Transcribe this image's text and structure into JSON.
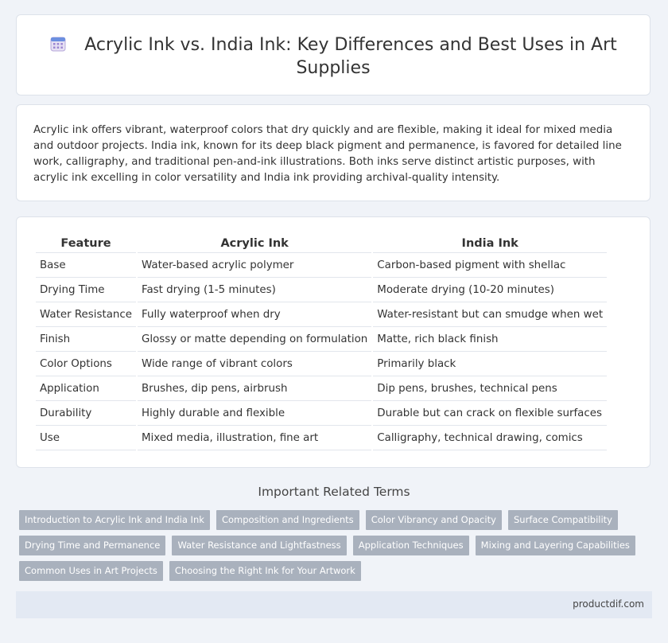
{
  "header": {
    "title": "Acrylic Ink vs. India Ink: Key Differences and Best Uses in Art Supplies",
    "icon": "calendar-icon"
  },
  "intro": {
    "text": "Acrylic ink offers vibrant, waterproof colors that dry quickly and are flexible, making it ideal for mixed media and outdoor projects. India ink, known for its deep black pigment and permanence, is favored for detailed line work, calligraphy, and traditional pen-and-ink illustrations. Both inks serve distinct artistic purposes, with acrylic ink excelling in color versatility and India ink providing archival-quality intensity."
  },
  "table": {
    "headers": [
      "Feature",
      "Acrylic Ink",
      "India Ink"
    ],
    "rows": [
      [
        "Base",
        "Water-based acrylic polymer",
        "Carbon-based pigment with shellac"
      ],
      [
        "Drying Time",
        "Fast drying (1-5 minutes)",
        "Moderate drying (10-20 minutes)"
      ],
      [
        "Water Resistance",
        "Fully waterproof when dry",
        "Water-resistant but can smudge when wet"
      ],
      [
        "Finish",
        "Glossy or matte depending on formulation",
        "Matte, rich black finish"
      ],
      [
        "Color Options",
        "Wide range of vibrant colors",
        "Primarily black"
      ],
      [
        "Application",
        "Brushes, dip pens, airbrush",
        "Dip pens, brushes, technical pens"
      ],
      [
        "Durability",
        "Highly durable and flexible",
        "Durable but can crack on flexible surfaces"
      ],
      [
        "Use",
        "Mixed media, illustration, fine art",
        "Calligraphy, technical drawing, comics"
      ]
    ]
  },
  "related": {
    "title": "Important Related Terms",
    "tags": [
      "Introduction to Acrylic Ink and India Ink",
      "Composition and Ingredients",
      "Color Vibrancy and Opacity",
      "Surface Compatibility",
      "Drying Time and Permanence",
      "Water Resistance and Lightfastness",
      "Application Techniques",
      "Mixing and Layering Capabilities",
      "Common Uses in Art Projects",
      "Choosing the Right Ink for Your Artwork"
    ]
  },
  "footer": {
    "site": "productdif.com"
  },
  "colors": {
    "background": "#f0f3f8",
    "tag": "#a9b1bd",
    "footer": "#e3e9f3"
  }
}
